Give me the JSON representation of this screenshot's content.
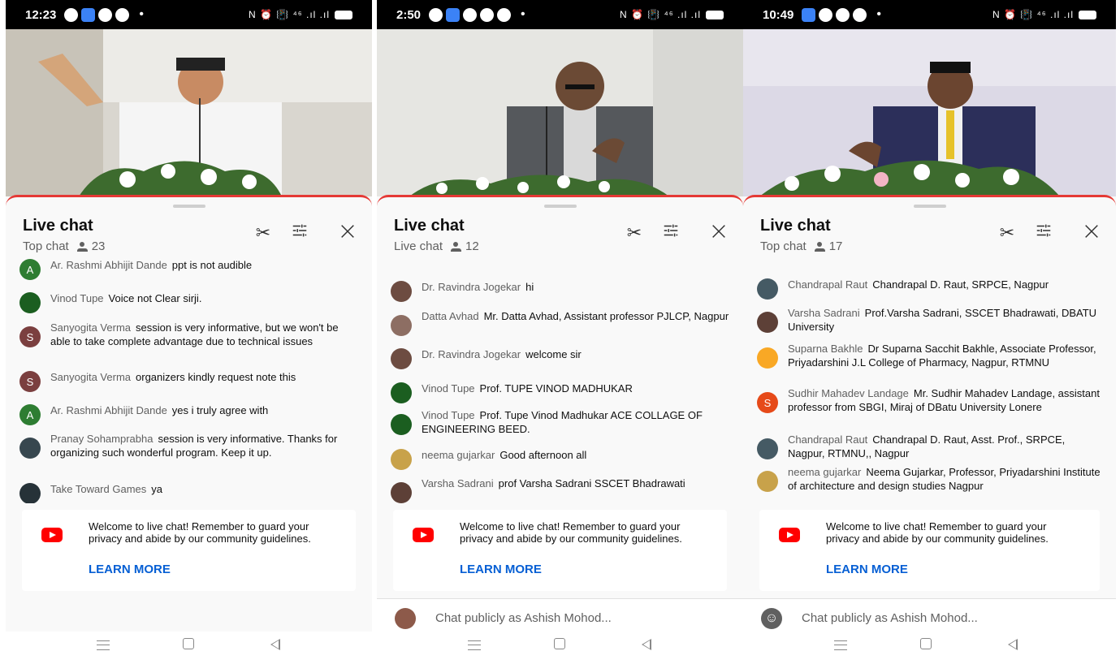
{
  "phones": [
    {
      "status": {
        "time": "12:23",
        "right_icons": "N ⏰ 📳 ⁴⁶ .ıl .ıl"
      },
      "chat": {
        "title": "Live chat",
        "mode": "Top chat",
        "viewers": "23"
      },
      "messages": [
        {
          "author": "Ar. Rashmi Abhijit Dande",
          "text": "ppt is not audible",
          "avatar": "A",
          "avatar_color": "#2e7d32"
        },
        {
          "author": "Vinod Tupe",
          "text": "Voice not Clear sirji.",
          "avatar": "",
          "avatar_color": "#1b5e20"
        },
        {
          "author": "Sanyogita Verma",
          "text": "session is very informative, but we won't be able to take complete advantage due to technical issues",
          "avatar": "S",
          "avatar_color": "#7b3f3f"
        },
        {
          "author": "Sanyogita Verma",
          "text": "organizers kindly request note this",
          "avatar": "S",
          "avatar_color": "#7b3f3f"
        },
        {
          "author": "Ar. Rashmi Abhijit Dande",
          "text": "yes i truly agree with",
          "avatar": "A",
          "avatar_color": "#2e7d32"
        },
        {
          "author": "Pranay Sohamprabha",
          "text": "session is very informative. Thanks for organizing such wonderful program. Keep it up.",
          "avatar": "",
          "avatar_color": "#37474f"
        },
        {
          "author": "Take Toward Games",
          "text": "ya",
          "avatar": "",
          "avatar_color": "#263238"
        }
      ],
      "welcome": {
        "text": "Welcome to live chat! Remember to guard your privacy and abide by our community guidelines.",
        "link": "LEARN MORE"
      },
      "input": null
    },
    {
      "status": {
        "time": "2:50",
        "right_icons": "N ⏰ 📳 ⁴⁶ .ıl .ıl"
      },
      "chat": {
        "title": "Live chat",
        "mode": "Live chat",
        "viewers": "12"
      },
      "messages": [
        {
          "author": "Dr. Ravindra Jogekar",
          "text": "hi",
          "avatar": "",
          "avatar_color": "#6d4c41"
        },
        {
          "author": "Datta Avhad",
          "text": "Mr. Datta Avhad, Assistant professor PJLCP, Nagpur",
          "avatar": "",
          "avatar_color": "#8d6e63"
        },
        {
          "author": "Dr. Ravindra Jogekar",
          "text": "welcome sir",
          "avatar": "",
          "avatar_color": "#6d4c41"
        },
        {
          "author": "Vinod Tupe",
          "text": "Prof. TUPE VINOD MADHUKAR",
          "avatar": "",
          "avatar_color": "#1b5e20"
        },
        {
          "author": "Vinod Tupe",
          "text": "Prof. Tupe Vinod Madhukar ACE COLLAGE OF ENGINEERING BEED.",
          "avatar": "",
          "avatar_color": "#1b5e20"
        },
        {
          "author": "neema gujarkar",
          "text": "Good afternoon all",
          "avatar": "",
          "avatar_color": "#c8a24a"
        },
        {
          "author": "Varsha Sadrani",
          "text": "prof Varsha Sadrani SSCET Bhadrawati",
          "avatar": "",
          "avatar_color": "#5d4037"
        }
      ],
      "welcome": {
        "text": "Welcome to live chat! Remember to guard your privacy and abide by our community guidelines.",
        "link": "LEARN MORE"
      },
      "input": {
        "placeholder": "Chat publicly as Ashish Mohod..."
      }
    },
    {
      "status": {
        "time": "10:49",
        "right_icons": "N ⏰ 📳 ⁴⁶ .ıl .ıl"
      },
      "chat": {
        "title": "Live chat",
        "mode": "Top chat",
        "viewers": "17"
      },
      "messages": [
        {
          "author": "Chandrapal Raut",
          "text": "Chandrapal D. Raut, SRPCE, Nagpur",
          "avatar": "",
          "avatar_color": "#455a64"
        },
        {
          "author": "Varsha Sadrani",
          "text": "Prof.Varsha Sadrani, SSCET Bhadrawati, DBATU University",
          "avatar": "",
          "avatar_color": "#5d4037"
        },
        {
          "author": "Suparna Bakhle",
          "text": "Dr Suparna Sacchit Bakhle, Associate Professor, Priyadarshini J.L College of Pharmacy, Nagpur, RTMNU",
          "avatar": "",
          "avatar_color": "#f9a825"
        },
        {
          "author": "Sudhir Mahadev Landage",
          "text": "Mr. Sudhir Mahadev Landage, assistant professor from SBGI, Miraj of DBatu University Lonere",
          "avatar": "S",
          "avatar_color": "#e64a19"
        },
        {
          "author": "Chandrapal Raut",
          "text": "Chandrapal D. Raut, Asst. Prof., SRPCE, Nagpur, RTMNU,, Nagpur",
          "avatar": "",
          "avatar_color": "#455a64"
        },
        {
          "author": "neema gujarkar",
          "text": "Neema Gujarkar, Professor, Priyadarshini Institute of architecture and design studies Nagpur",
          "avatar": "",
          "avatar_color": "#c8a24a"
        }
      ],
      "welcome": {
        "text": "Welcome to live chat! Remember to guard your privacy and abide by our community guidelines.",
        "link": "LEARN MORE"
      },
      "input": {
        "placeholder": "Chat publicly as Ashish Mohod..."
      }
    }
  ]
}
